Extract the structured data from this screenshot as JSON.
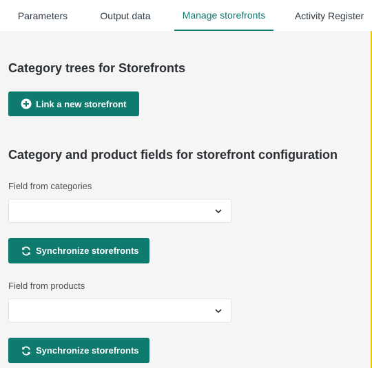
{
  "tabs": [
    {
      "label": "Parameters",
      "active": false
    },
    {
      "label": "Output data",
      "active": false
    },
    {
      "label": "Manage storefronts",
      "active": true
    },
    {
      "label": "Activity Register",
      "active": false
    }
  ],
  "sections": {
    "category_trees_title": "Category trees for Storefronts",
    "link_button_label": "Link a new storefront",
    "fields_title": "Category and product fields for storefront configuration",
    "field_categories_label": "Field from categories",
    "field_categories_value": "",
    "sync_button_label": "Synchronize storefronts",
    "field_products_label": "Field from products",
    "field_products_value": ""
  },
  "colors": {
    "accent": "#0f7a6e",
    "frame": "#f1c40f",
    "background": "#f5f5f5"
  },
  "icons": {
    "link": "plus-circle-icon",
    "sync": "sync-icon",
    "dropdown": "chevron-down-icon"
  }
}
